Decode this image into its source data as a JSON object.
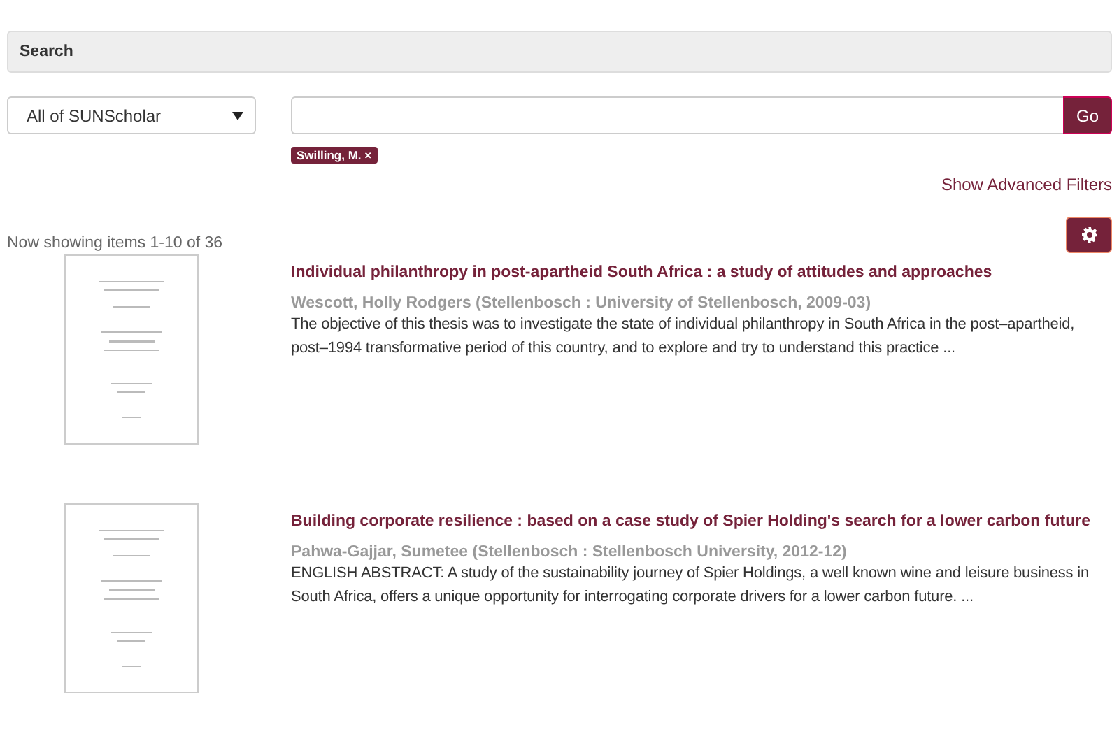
{
  "search_panel": {
    "title": "Search"
  },
  "scope_select": {
    "value": "All of SUNScholar"
  },
  "go_button": {
    "label": "Go"
  },
  "filter_tags": [
    {
      "label": "Swilling, M. ×"
    }
  ],
  "advanced_filters_link": {
    "label": "Show Advanced Filters"
  },
  "results_summary": "Now showing items 1-10 of 36",
  "results": [
    {
      "title": "Individual philanthropy in post-apartheid South Africa : a study of attitudes and approaches",
      "meta": "Wescott, Holly Rodgers (Stellenbosch : University of Stellenbosch, 2009-03)",
      "abstract": "The objective of this thesis was to investigate the state of individual philanthropy in South Africa in the post–apartheid, post–1994 transformative period of this country, and to explore and try to understand this practice ..."
    },
    {
      "title": "Building corporate resilience : based on a case study of Spier Holding's search for a lower carbon future",
      "meta": "Pahwa-Gajjar, Sumetee (Stellenbosch : Stellenbosch University, 2012-12)",
      "abstract": "ENGLISH ABSTRACT: A study of the sustainability journey of Spier Holdings, a well known wine and leisure business in South Africa, offers a unique opportunity for interrogating corporate drivers for a lower carbon future. ..."
    }
  ]
}
